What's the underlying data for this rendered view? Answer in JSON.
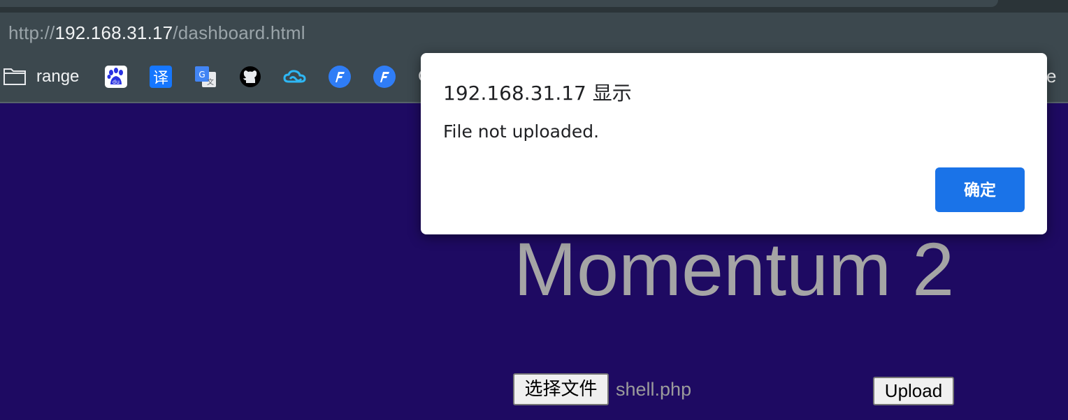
{
  "browser": {
    "url_scheme": "http://",
    "url_host": "192.168.31.17",
    "url_path": "/dashboard.html",
    "bookmarks": {
      "folder_label": "range",
      "icons": [
        "baidu-icon",
        "translate-icon",
        "google-translate-icon",
        "github-icon",
        "cloud-icon",
        "app-f-icon",
        "app-f-icon"
      ],
      "partial_left": "C",
      "partial_right": "e"
    }
  },
  "page": {
    "heading": "Momentum 2",
    "file_button_label": "选择文件",
    "file_name": "shell.php",
    "upload_button_label": "Upload",
    "background": "#1e0a62"
  },
  "dialog": {
    "title": "192.168.31.17 显示",
    "message": "File not uploaded.",
    "ok_label": "确定",
    "accent": "#1a73e8"
  }
}
